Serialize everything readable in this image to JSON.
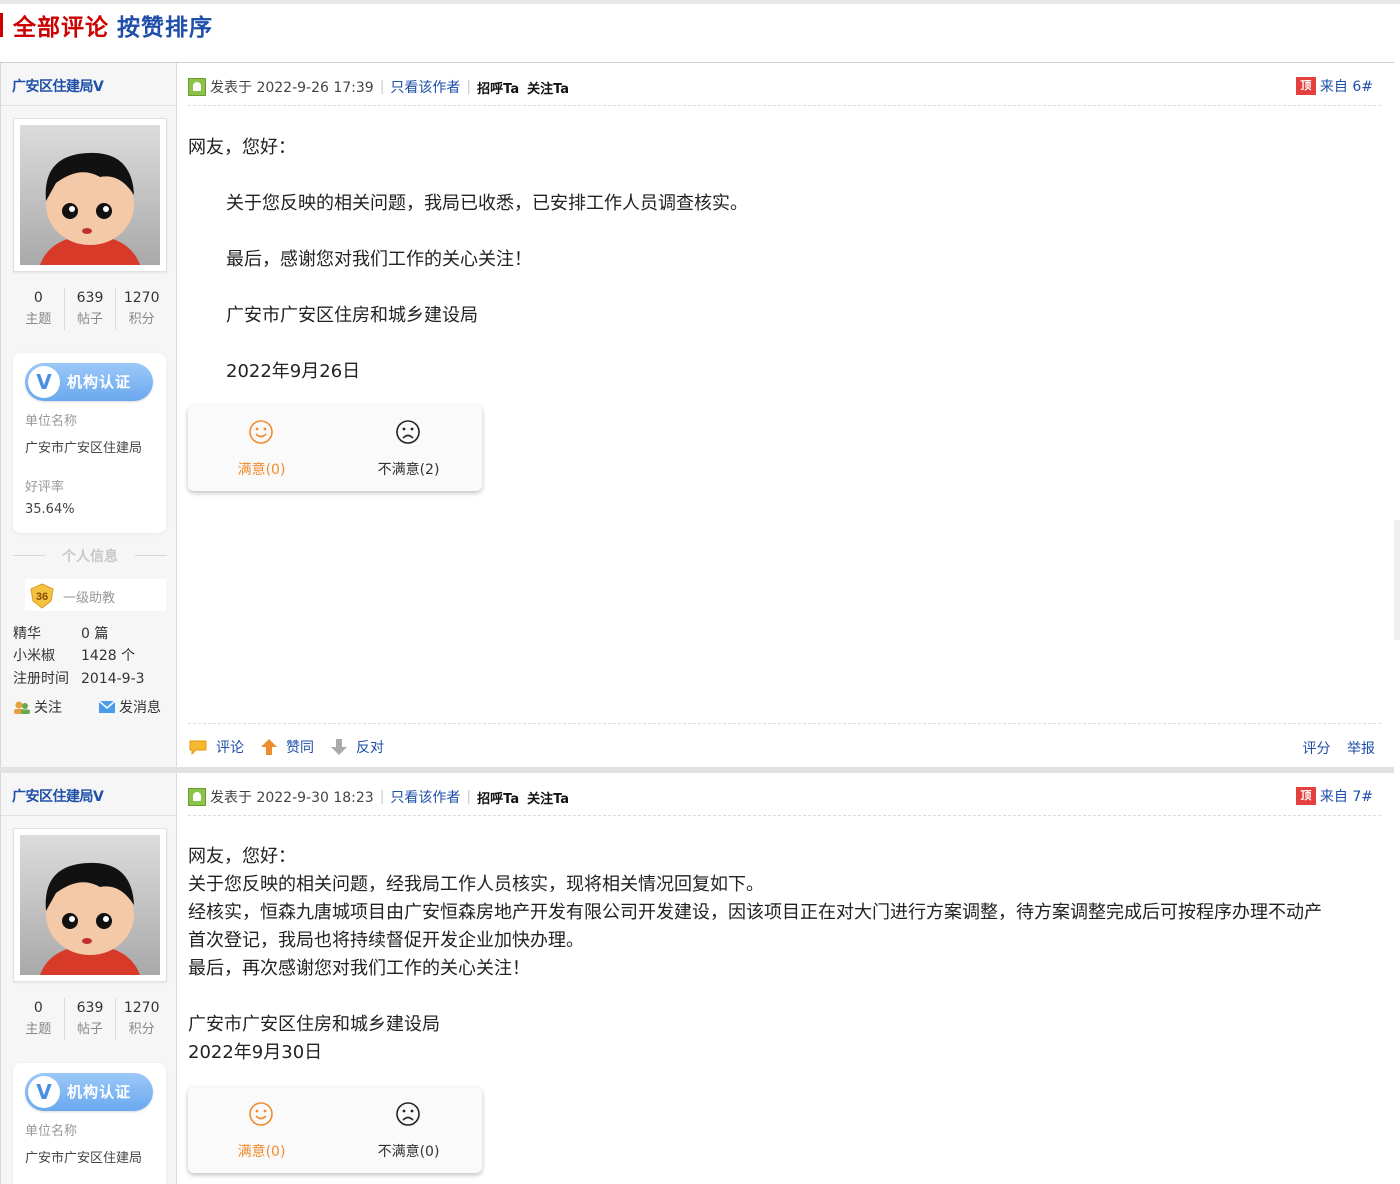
{
  "section": {
    "title_red": "全部评论",
    "title_blue": "按赞排序"
  },
  "posts": [
    {
      "user": {
        "name": "广安区住建局V",
        "stats": [
          {
            "num": "0",
            "label": "主题"
          },
          {
            "num": "639",
            "label": "帖子"
          },
          {
            "num": "1270",
            "label": "积分"
          }
        ],
        "cert_label": "机构认证",
        "cert_icon_letter": "V",
        "unit_key": "单位名称",
        "unit_value": "广安市广安区住建局",
        "rate_key": "好评率",
        "rate_value": "35.64%",
        "personal_info_title": "个人信息",
        "level_num": "36",
        "level_name": "一级助教",
        "details": [
          {
            "k": "精华",
            "v": "0 篇"
          },
          {
            "k": "小米椒",
            "v": "1428 个"
          },
          {
            "k": "注册时间",
            "v": "2014-9-3"
          }
        ],
        "follow_label": "关注",
        "message_label": "发消息"
      },
      "meta": {
        "posted": "发表于 2022-9-26 17:39",
        "only_author": "只看该作者",
        "greet": "招呼Ta",
        "follow": "关注Ta",
        "floor_badge": "顶",
        "floor": "来自 6#"
      },
      "body": [
        "网友，您好：",
        "关于您反映的相关问题，我局已收悉，已安排工作人员调查核实。",
        "最后，感谢您对我们工作的关心关注！",
        "广安市广安区住房和城乡建设局",
        "2022年9月26日"
      ],
      "votes": {
        "good": "满意(0)",
        "bad": "不满意(2)"
      },
      "footer": {
        "comment": "评论",
        "up": "赞同",
        "down": "反对",
        "rate": "评分",
        "report": "举报"
      }
    },
    {
      "user": {
        "name": "广安区住建局V",
        "stats": [
          {
            "num": "0",
            "label": "主题"
          },
          {
            "num": "639",
            "label": "帖子"
          },
          {
            "num": "1270",
            "label": "积分"
          }
        ],
        "cert_label": "机构认证",
        "cert_icon_letter": "V",
        "unit_key": "单位名称",
        "unit_value": "广安市广安区住建局"
      },
      "meta": {
        "posted": "发表于 2022-9-30 18:23",
        "only_author": "只看该作者",
        "greet": "招呼Ta",
        "follow": "关注Ta",
        "floor_badge": "顶",
        "floor": "来自 7#"
      },
      "body": [
        "网友，您好：",
        "关于您反映的相关问题，经我局工作人员核实，现将相关情况回复如下。",
        "经核实，恒森九唐城项目由广安恒森房地产开发有限公司开发建设，因该项目正在对大门进行方案调整，待方案调整完成后可按程序办理不动产",
        "首次登记，我局也将持续督促开发企业加快办理。",
        "最后，再次感谢您对我们工作的关心关注！",
        "广安市广安区住房和城乡建设局",
        "2022年9月30日"
      ],
      "votes": {
        "good": "满意(0)",
        "bad": "不满意(0)"
      }
    }
  ]
}
